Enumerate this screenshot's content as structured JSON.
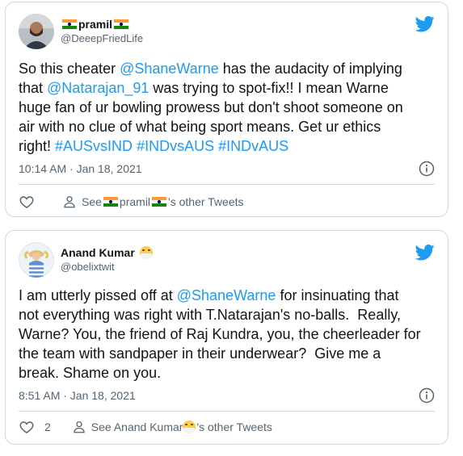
{
  "tweets": [
    {
      "display_name": "pramil",
      "name_flags": "indian-flag",
      "handle": "@DeeepFriedLife",
      "text_parts": [
        {
          "t": "So this cheater ",
          "link": false
        },
        {
          "t": "@ShaneWarne",
          "link": true
        },
        {
          "t": " has the audacity of implying\nthat ",
          "link": false
        },
        {
          "t": "@Natarajan_91",
          "link": true
        },
        {
          "t": " was trying to spot-fix!! I mean Warne\nhuge fan of ur bowling prowess but don't shoot someone on\nair with no clue of what being sport means. Get ur ethics\nright! ",
          "link": false
        },
        {
          "t": "#AUSvsIND",
          "link": true
        },
        {
          "t": " ",
          "link": false
        },
        {
          "t": "#INDvsAUS",
          "link": true
        },
        {
          "t": " ",
          "link": false
        },
        {
          "t": "#INDvAUS",
          "link": true
        }
      ],
      "timestamp": "10:14 AM · Jan 18, 2021",
      "like_count": "",
      "see_prefix": "See ",
      "see_name": "pramil",
      "see_suffix": "'s other Tweets"
    },
    {
      "display_name": "Anand Kumar",
      "name_emoji": "face-with-medical-mask",
      "handle": "@obelixtwit",
      "text_parts": [
        {
          "t": "I am utterly pissed off at ",
          "link": false
        },
        {
          "t": "@ShaneWarne",
          "link": true
        },
        {
          "t": " for insinuating that\nnot everything was right with T.Natarajan's no-balls.  Really,\nWarne? You, the friend of Raj Kundra, you, the cheerleader for\nthe team with sandpaper in their underwear?  Give me a\nbreak. Shame on you.",
          "link": false
        }
      ],
      "timestamp": "8:51 AM · Jan 18, 2021",
      "like_count": "2",
      "see_prefix": "See Anand Kumar ",
      "see_suffix": "'s other Tweets"
    }
  ],
  "colors": {
    "link": "#1d9bf0",
    "twitter_blue": "#1d9bf0",
    "muted": "#536471",
    "border": "#cfd9de"
  },
  "icons": [
    "twitter-bird-icon",
    "info-icon",
    "heart-icon",
    "person-icon",
    "indian-flag-emoji",
    "medical-mask-emoji"
  ]
}
